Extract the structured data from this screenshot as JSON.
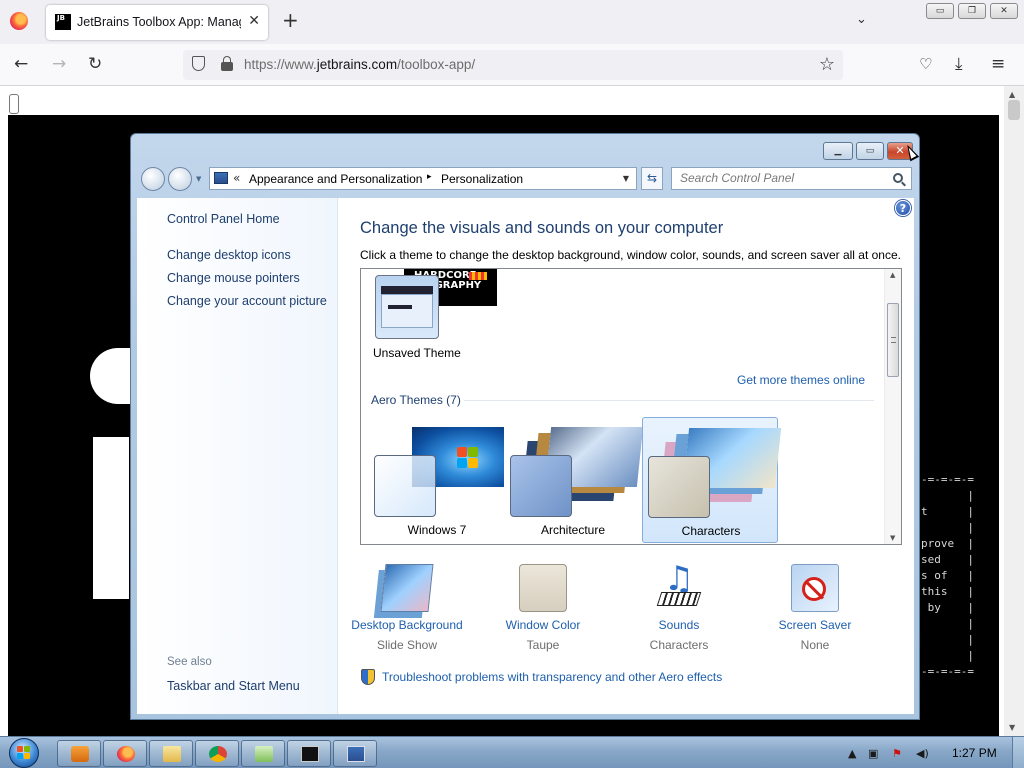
{
  "browser": {
    "tab_icon_text": "JB",
    "tab_title": "JetBrains Toolbox App: Manage",
    "tab_close": "✕",
    "new_tab": "+",
    "url_host_prefix": "https://www.",
    "url_host": "jetbrains.com",
    "url_path": "/toolbox-app/",
    "window_buttons": [
      "▭",
      "❐",
      "✕"
    ]
  },
  "page": {
    "terminal_lines": "-=-=-=-=\n       |\nt      |\n       |\nprove  |\nsed    |\ns of   |\nthis   |\n by    |\n       |\n       |\n       |\n-=-=-=-="
  },
  "control_panel": {
    "address": {
      "chevron": "«",
      "crumb1": "Appearance and Personalization",
      "sep": "▸",
      "crumb2": "Personalization"
    },
    "search_placeholder": "Search Control Panel",
    "help_icon": "?",
    "left_pane": {
      "home_link": "Control Panel Home",
      "links": [
        "Change desktop icons",
        "Change mouse pointers",
        "Change your account picture"
      ],
      "see_also_label": "See also",
      "see_also_links": [
        "Taskbar and Start Menu"
      ]
    },
    "main": {
      "heading": "Change the visuals and sounds on your computer",
      "instruction": "Click a theme to change the desktop background, window color, sounds, and screen saver all at once.",
      "hardcore_banner": "HARDCORE\nINOGRAPHY",
      "unsaved_theme": "Unsaved Theme",
      "more_themes_link": "Get more themes online",
      "aero_header": "Aero Themes (7)",
      "themes": [
        {
          "name": "Windows 7",
          "selected": false
        },
        {
          "name": "Architecture",
          "selected": false
        },
        {
          "name": "Characters",
          "selected": true
        }
      ],
      "items": [
        {
          "link": "Desktop Background",
          "sub": "Slide Show"
        },
        {
          "link": "Window Color",
          "sub": "Taupe"
        },
        {
          "link": "Sounds",
          "sub": "Characters"
        },
        {
          "link": "Screen Saver",
          "sub": "None"
        }
      ],
      "troubleshoot_link": "Troubleshoot problems with transparency and other Aero effects"
    }
  },
  "taskbar": {
    "clock": "1:27 PM"
  },
  "colors": {
    "link_blue": "#1e5fae",
    "heading_blue": "#1e3f6f",
    "close_red": "#c8452b"
  }
}
